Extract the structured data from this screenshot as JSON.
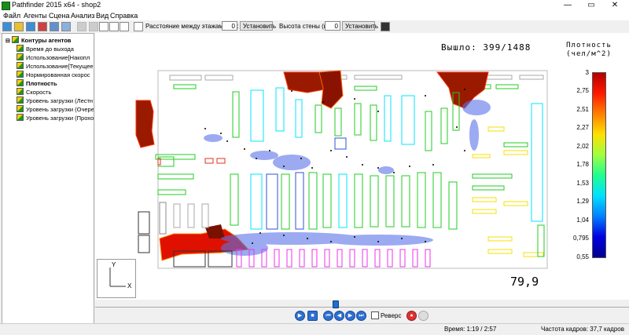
{
  "window": {
    "title": "Pathfinder 2015 x64 - shop2",
    "controls": {
      "minimize": "—",
      "maximize": "▭",
      "close": "✕"
    }
  },
  "menu": [
    "Файл",
    "Агенты",
    "Сцена",
    "Анализ",
    "Вид",
    "Справка"
  ],
  "toolbar": {
    "floor_distance_label": "Расстояние между этажами (м):",
    "floor_distance_value": "0",
    "set_button_1": "Установить",
    "wall_height_label": "Высота стены (м):",
    "wall_height_value": "0",
    "set_button_2": "Установить"
  },
  "tree": {
    "root": "Контуры агентов",
    "items": [
      "Время до выхода",
      "Использование[Накопл",
      "Использование[Текущее",
      "Нормированная скорос",
      "Плотность",
      "Скорость",
      "Уровень загрузки (Лестн",
      "Уровень загрузки (Очере",
      "Уровень загрузки (Прохо"
    ],
    "selected_index": 4
  },
  "view": {
    "exited_label": "Вышло:",
    "exited_value": "399/1488",
    "legend_title_line1": "Плотность",
    "legend_title_line2": "(чел/м^2)",
    "legend_ticks": [
      "3",
      "2,75",
      "2,51",
      "2,27",
      "2,02",
      "1,78",
      "1,53",
      "1,29",
      "1,04",
      "0,795",
      "0,55"
    ],
    "sim_time": "79,9",
    "axis_y": "Y",
    "axis_x": "X"
  },
  "playback": {
    "reverse_label": "Реверс",
    "progress_fraction": 0.45
  },
  "status": {
    "time": "Время: 1:19 / 2:57",
    "fps": "Частота кадров: 37,7 кадров"
  },
  "colors": {
    "shelf_cyan": "#00e5ff",
    "shelf_green": "#22cc22",
    "shelf_yellow": "#f5e000",
    "shelf_blue": "#3050d0",
    "shelf_magenta": "#ee33ee",
    "shelf_red": "#e03020",
    "hotspot": "#9a1a00"
  }
}
